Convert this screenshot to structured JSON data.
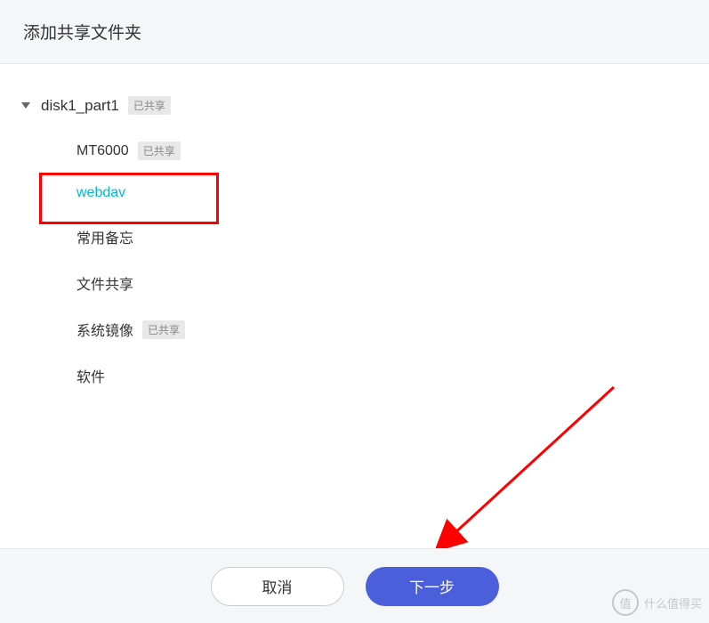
{
  "header": {
    "title": "添加共享文件夹"
  },
  "tree": {
    "root": {
      "label": "disk1_part1",
      "shared_badge": "已共享",
      "expanded": true
    },
    "items": [
      {
        "label": "MT6000",
        "shared": true,
        "shared_badge": "已共享",
        "selected": false
      },
      {
        "label": "webdav",
        "shared": false,
        "shared_badge": "",
        "selected": true
      },
      {
        "label": "常用备忘",
        "shared": false,
        "shared_badge": "",
        "selected": false
      },
      {
        "label": "文件共享",
        "shared": false,
        "shared_badge": "",
        "selected": false
      },
      {
        "label": "系统镜像",
        "shared": true,
        "shared_badge": "已共享",
        "selected": false
      },
      {
        "label": "软件",
        "shared": false,
        "shared_badge": "",
        "selected": false
      }
    ]
  },
  "footer": {
    "cancel_label": "取消",
    "next_label": "下一步"
  },
  "watermark": {
    "circle_text": "值",
    "text": "什么值得买"
  }
}
